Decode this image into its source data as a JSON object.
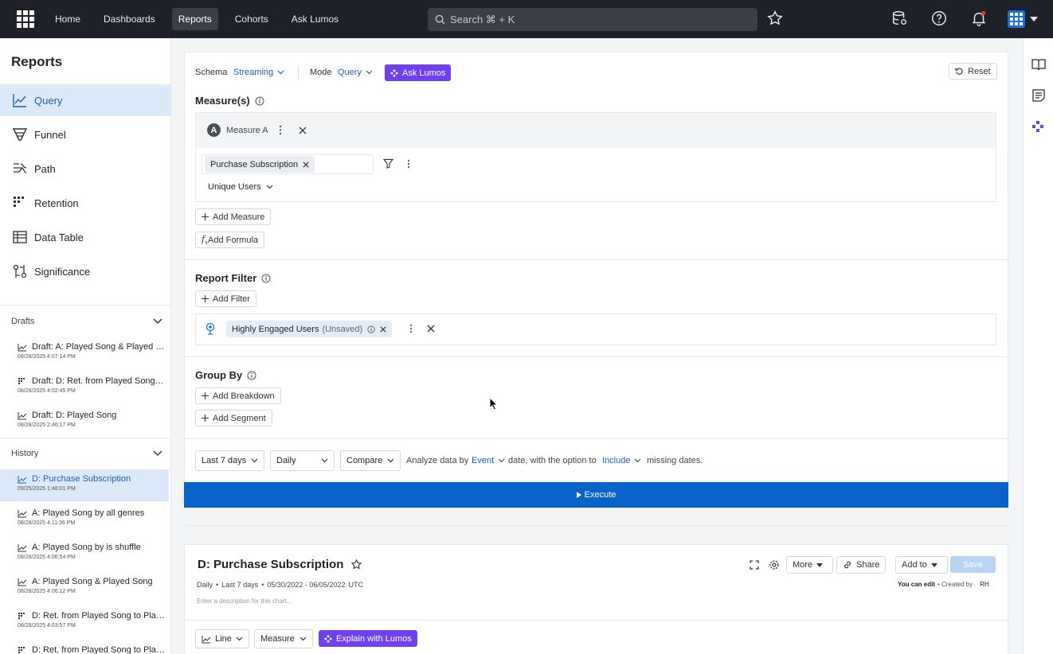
{
  "nav": {
    "links": [
      "Home",
      "Dashboards",
      "Reports",
      "Cohorts",
      "Ask Lumos"
    ],
    "active": "Reports",
    "search_placeholder": "Search ⌘ + K"
  },
  "sidebar": {
    "title": "Reports",
    "items": [
      "Query",
      "Funnel",
      "Path",
      "Retention",
      "Data Table",
      "Significance"
    ],
    "active": "Query",
    "drafts_label": "Drafts",
    "drafts": [
      {
        "title": "Draft: A: Played Song & Played Song",
        "date": "08/28/2025 4:07:14 PM",
        "icon": "line-chart-icon"
      },
      {
        "title": "Draft: D: Ret. from Played Song to Played Song",
        "date": "08/28/2025 4:02:45 PM",
        "icon": "retention-icon"
      },
      {
        "title": "Draft: D: Played Song",
        "date": "08/28/2025 2:46:17 PM",
        "icon": "line-chart-icon"
      }
    ],
    "history_label": "History",
    "history": [
      {
        "title": "D: Purchase Subscription",
        "date": "09/25/2025 1:48:01 PM",
        "icon": "line-chart-icon",
        "active": true
      },
      {
        "title": "A: Played Song by all genres",
        "date": "08/28/2025 4:11:36 PM",
        "icon": "line-chart-icon"
      },
      {
        "title": "A: Played Song by is shuffle",
        "date": "08/28/2025 4:06:54 PM",
        "icon": "line-chart-icon"
      },
      {
        "title": "A: Played Song & Played Song",
        "date": "08/28/2025 4:06:12 PM",
        "icon": "line-chart-icon"
      },
      {
        "title": "D: Ret. from Played Song to Played Song",
        "date": "08/28/2025 4:03:57 PM",
        "icon": "retention-icon"
      },
      {
        "title": "D: Ret. from Played Song to Played Song",
        "date": "",
        "icon": "retention-icon"
      }
    ]
  },
  "query": {
    "schema_label": "Schema",
    "schema_value": "Streaming",
    "mode_label": "Mode",
    "mode_value": "Query",
    "ask_lumos": "Ask Lumos",
    "reset": "Reset",
    "measures_title": "Measure(s)",
    "measure_badge": "A",
    "measure_name": "Measure A",
    "event_chip": "Purchase Subscription",
    "aggregation": "Unique Users",
    "add_measure": "Add Measure",
    "add_formula": "Add Formula",
    "report_filter_title": "Report Filter",
    "add_filter": "Add Filter",
    "filter_chip": "Highly Engaged Users",
    "filter_chip_note": "(Unsaved)",
    "group_by_title": "Group By",
    "add_breakdown": "Add Breakdown",
    "add_segment": "Add Segment",
    "date_range": "Last 7 days",
    "granularity": "Daily",
    "compare": "Compare",
    "analyze_prefix": "Analyze data by",
    "analyze_by": "Event",
    "analyze_mid": "date, with the option to",
    "missing_option": "Include",
    "analyze_suffix": "missing dates.",
    "execute": "Execute"
  },
  "chart": {
    "title": "D: Purchase Subscription",
    "meta_granularity": "Daily",
    "meta_range": "Last 7 days",
    "meta_dates": "05/30/2022 - 06/05/2022",
    "meta_tz": "UTC",
    "description_placeholder": "Enter a description for this chart...",
    "more": "More",
    "share": "Share",
    "add_to": "Add to",
    "save": "Save",
    "you_can_edit": "You can edit",
    "created_by": "• Created by",
    "creator_initials": "RH",
    "chart_type": "Line",
    "metric": "Measure",
    "explain": "Explain with Lumos"
  },
  "colors": {
    "accent": "#0a63c9",
    "purple": "#6e3ff3",
    "nav_bg": "#1e2127",
    "active_bg": "#dce9f8"
  }
}
